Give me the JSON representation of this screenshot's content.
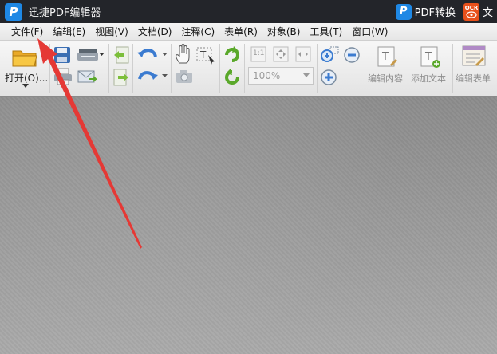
{
  "title_bar": {
    "app_logo_letter": "P",
    "app_title": "迅捷PDF编辑器",
    "pdf_convert_logo_letter": "P",
    "pdf_convert_label": "PDF转换",
    "ocr_badge": "OCR",
    "truncated_text": "文"
  },
  "menu": {
    "items": [
      "文件(F)",
      "编辑(E)",
      "视图(V)",
      "文档(D)",
      "注释(C)",
      "表单(R)",
      "对象(B)",
      "工具(T)",
      "窗口(W)"
    ]
  },
  "toolbar": {
    "open_label": "打开(O)...",
    "zoom_value": "100%",
    "zoom_fit_labels": [
      "1:1"
    ],
    "edit_content_label": "编辑内容",
    "add_text_label": "添加文本",
    "edit_form_label": "编辑表单"
  },
  "colors": {
    "titlebar_bg": "#23252a",
    "logo_blue": "#1e88e5",
    "ocr_orange": "#e8501a",
    "annotation_red": "#e53935",
    "green_icon": "#5aa82a"
  },
  "icons": {
    "open": "folder-icon",
    "save": "save-icon",
    "print": "printer-icon",
    "scan": "scanner-icon",
    "email": "email-icon",
    "prev_page": "page-back-icon",
    "next_page": "page-forward-icon",
    "undo": "undo-icon",
    "redo": "redo-icon",
    "hand": "hand-icon",
    "select_text": "select-text-icon",
    "snapshot": "camera-icon",
    "rotate_cw": "rotate-clockwise-icon",
    "rotate_ccw": "rotate-counterclockwise-icon",
    "actual_size": "actual-size-icon",
    "fit_page": "fit-page-icon",
    "fit_width": "fit-width-icon",
    "zoom_in": "zoom-in-icon",
    "zoom_out": "zoom-out-icon",
    "zoom_area": "zoom-area-icon",
    "edit_content": "edit-content-icon",
    "add_text": "add-text-icon",
    "edit_form": "edit-form-icon"
  }
}
